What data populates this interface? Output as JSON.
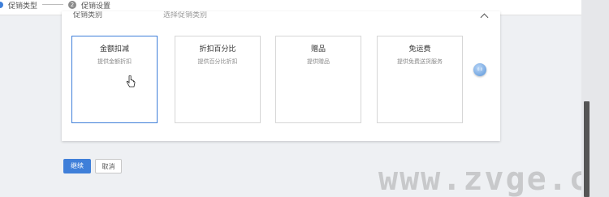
{
  "steps": [
    {
      "label": "促销类型",
      "state": "active"
    },
    {
      "number": "2",
      "label": "促销设置",
      "state": "pending"
    }
  ],
  "panel": {
    "section_label": "促销类别",
    "section_hint": "选择促销类别",
    "collapse_icon": "chevron-up-icon"
  },
  "cards": [
    {
      "title": "金额扣减",
      "desc": "提供金额折扣",
      "selected": true
    },
    {
      "title": "折扣百分比",
      "desc": "提供百分比折扣",
      "selected": false
    },
    {
      "title": "赠品",
      "desc": "提供赠品",
      "selected": false
    },
    {
      "title": "免运费",
      "desc": "提供免费送货服务",
      "selected": false
    }
  ],
  "float_button": {
    "label": "0.0",
    "icon": "floating-action-icon"
  },
  "actions": {
    "continue_label": "继续",
    "cancel_label": "取消"
  },
  "watermark": "www.zvge.cn",
  "colors": {
    "accent": "#3f7fd9",
    "background": "#eef0f3",
    "card_border": "#d6d6d6"
  }
}
